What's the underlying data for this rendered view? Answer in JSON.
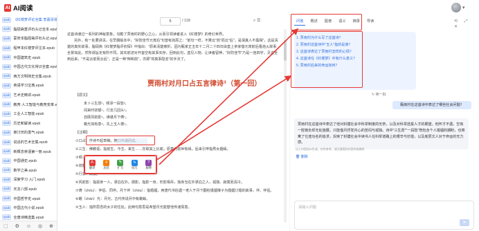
{
  "app": {
    "logo_mark": "AI",
    "title": "AI阅读"
  },
  "sidebar": {
    "files": [
      {
        "label": "《红楼梦评论全集 李嘉清批…",
        "active": true
      },
      {
        "label": "脂砚斋重评石头记全本.epub"
      },
      {
        "label": "蒙府本脂砚斋评石头记.epub"
      },
      {
        "label": "程甲本红楼梦评注本.epub"
      },
      {
        "label": "中国建筑史.epub"
      },
      {
        "label": "中国古代文化常识全套.epub"
      },
      {
        "label": "西方文明简史全集.epub"
      },
      {
        "label": "英语学习宝典.epub"
      },
      {
        "label": "艺术史精讲.epub"
      },
      {
        "label": "教育·人工智能与教育变革.epub"
      },
      {
        "label": "工业人工智能.epub"
      },
      {
        "label": "历史新解读.epub"
      },
      {
        "label": "被讨厌的勇气.epub"
      },
      {
        "label": "说话的艺术全集.epub"
      },
      {
        "label": "新概念英语第一册.epub"
      },
      {
        "label": "中国通史.epub"
      },
      {
        "label": "数学之美.epub"
      },
      {
        "label": "深度学习·入门.epub"
      },
      {
        "label": "天龙八部.epub"
      },
      {
        "label": "中国哲学史.epub"
      },
      {
        "label": "中国古代小说.epub"
      },
      {
        "label": "全唐诗精选集.epub"
      }
    ],
    "tag": "epub",
    "bottom_icons": [
      "⬚",
      "⚙",
      "☺",
      "◎",
      "⊕"
    ]
  },
  "reader": {
    "page_current": "5",
    "page_total": "/ 118",
    "toolbar_icons": "⌕ ☰",
    "paragraphs": [
      "这首诗通过一系列的神秘意象，勾勒了贾雨村的野心之心，从而引领读者进入《红楼梦》的奇幻世界。",
      "另外，有一处要讲清，在早期版本中，\"好防佳节元宵后\"句曾有如原之：\"前句一样，不算云\"前\"而云\"后\"，是谓真人不露相\"，这是清楚的真实故事，脂砚斋《红楼梦脂评初探》中指出：\"原来清楚被折，因为甄家正五年十二月二十四日由皇上亲家借元宵前后看焰火故事全景如此，然所谓旨定有所不同。其实前述对开首空有其事实存，回到此句，虚见人物，让读者留神，\"好防佳节\"乃是一连四字，见说全到后来，\"不是云前而云后\"，正是一种\"倒和前\"，亦即\"将真事隐去\"的手法了。"
    ],
    "chapter_title": "贾雨村对月口占五言律诗¹（第一回）",
    "heading_original": "【原文】",
    "poem": [
      "未卜三生愿²，频添一段愁³。",
      "闷来时敛额⁴，行去几回头⁵。",
      "自顾风前影⁶，谁堪月下俦⁷。",
      "蟾光如有意⁸，先上玉人楼⁹。"
    ],
    "heading_notes": "【注释】",
    "notes": [
      "①口占：作诗不起草稿，随口吟诵而成。",
      "②三生：佛教语，指前生、今生、来生……亦取其上比喻，原意为前世有缘，后来引申指男女姻缘。",
      "③频：频繁，时常。",
      "④敛额：皱眉额，形同的样子。",
      "⑤行去：离去。",
      "⑥风前影：指孤身一人，漂泊在外。朋影，指影一身，形影相吊，独身当在外漂泊之人，孤独、寂寞而清冷。",
      "⑦俦（chóu）：伴侣、同伴。月下伴（chóu）：指婚姻，用唐代书信遇一老人于月下翻检婚姻簿子为婚姻订婚的故事，伴、伴侣。",
      "⑧蟾（chán）光：月光，古代传说月中有蟾蜍。",
      "⑨玉人：指所思念的女子的住处。此两句意思是希望月光能替他传递情意。"
    ],
    "highlight_text": "随口吟诵而成",
    "popup": [
      {
        "label": "翻译",
        "icon": "A",
        "color": "#e53935"
      },
      {
        "label": "总结",
        "icon": "≡",
        "color": "#f57c00"
      },
      {
        "label": "扩写",
        "icon": "✎",
        "color": "#43a047"
      },
      {
        "label": "续写",
        "icon": "↳",
        "color": "#1e88e5"
      },
      {
        "label": "解释",
        "icon": "?",
        "color": "#8e44ad"
      }
    ]
  },
  "ai_panel": {
    "tabs": [
      "问答",
      "概述",
      "图谱",
      "语义",
      "摘录",
      "导读"
    ],
    "active_tab": 0,
    "header_icons": "⟲ ⤢ ✕",
    "questions": [
      "1. 贾雨村为什么写了这首诗？",
      "2. 贾雨村这首诗中\"玉人\"指的是谁？",
      "3. 这首诗表达了贾雨村怎样的心情？",
      "4. 这首诗在《红楼梦》中有什么意义？",
      "5. 贾雨村后来的命运如何？"
    ],
    "swap_label": "↻ 换一批",
    "user_message": "甄雨村在这首诗中表达了哪些社会问题？",
    "answer": "贾雨村在这首诗中表达了他对封建社会中科举制度的无奈，以及对科举选拔人才的期望。他怀才不遇，空有一腔抱负却无处施展，只能借月抒发内心的苦闷与孤独。诗中\"三生愿\"\"一段愁\"既包含个人婚姻的期盼，也寄寓了仕途功名的追求，反映了封建社会中读书人在科举道路上的艰辛与彷徨，以及底层文人对于命运的无力感。",
    "disclaimer": "以上内容由AI生成，仅供参考，请注意甄别内容的准确性",
    "delete_label": "🗑 删除",
    "input_placeholder": "请输入问题",
    "send_icon": "➤"
  },
  "colors": {
    "accent": "#2f6fe0",
    "annotation": "#e53935",
    "title": "#d1492d"
  }
}
